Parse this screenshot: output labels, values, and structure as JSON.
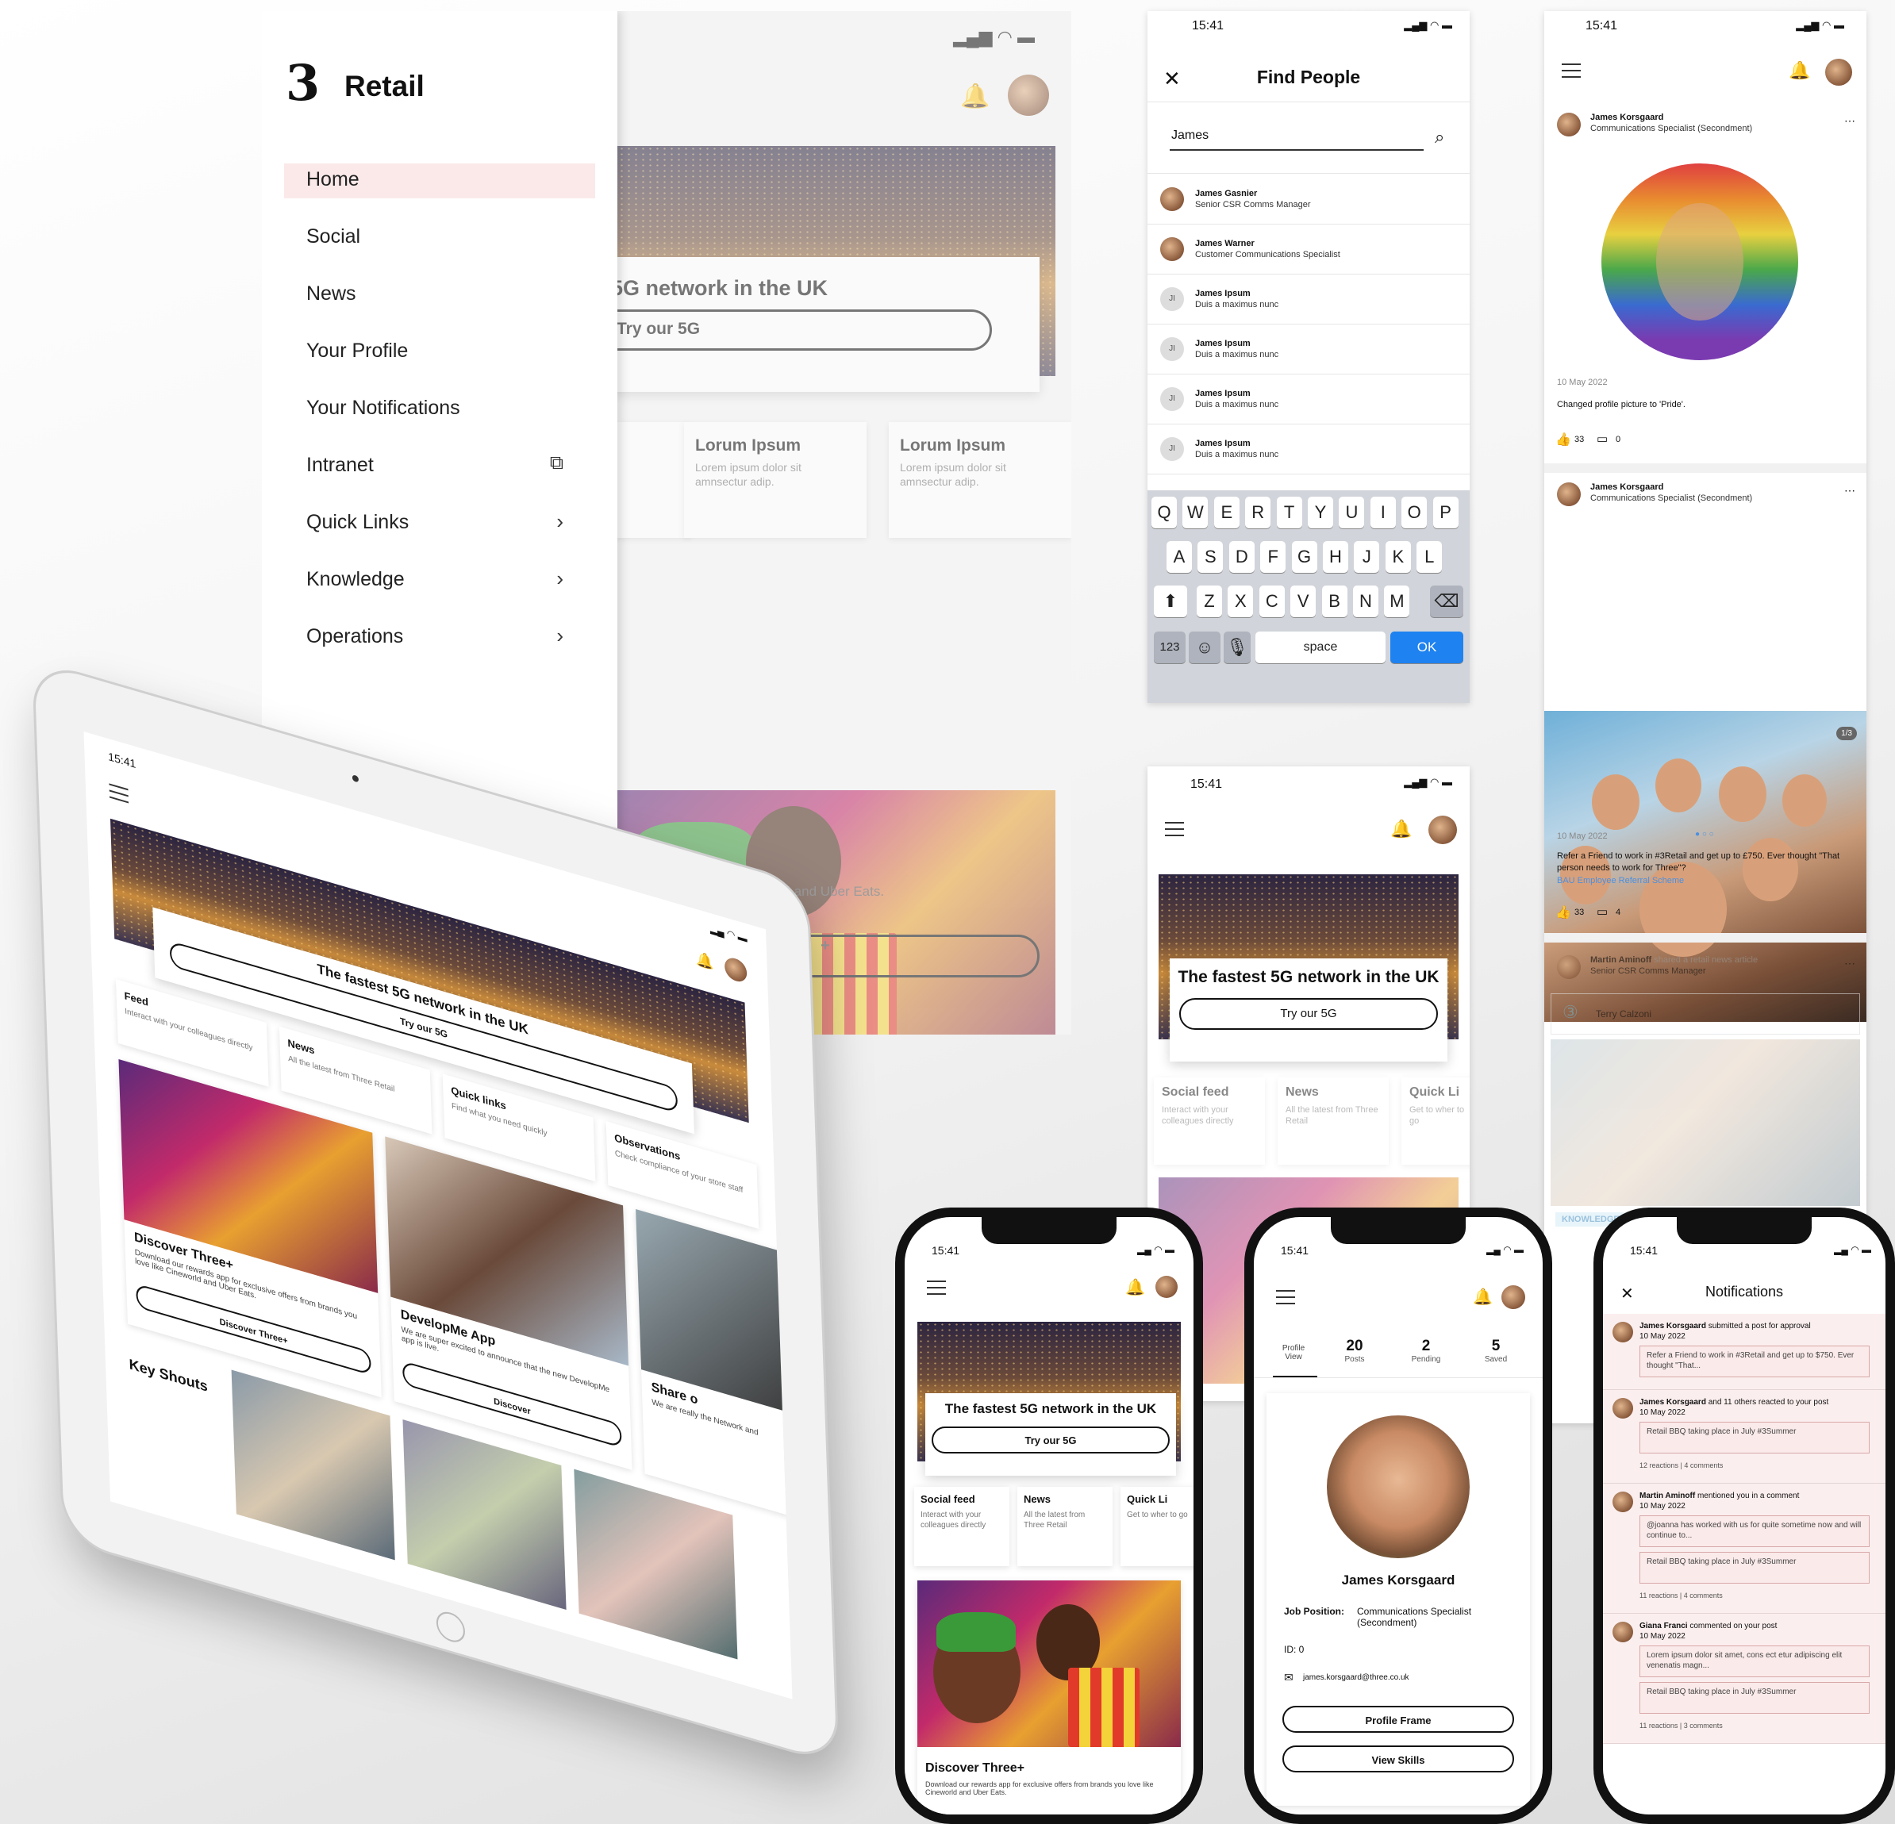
{
  "status": {
    "time": "15:41"
  },
  "drawer": {
    "brand": "Retail",
    "items": [
      {
        "label": "Home"
      },
      {
        "label": "Social"
      },
      {
        "label": "News"
      },
      {
        "label": "Your Profile"
      },
      {
        "label": "Your Notifications"
      },
      {
        "label": "Intranet"
      },
      {
        "label": "Quick Links"
      },
      {
        "label": "Knowledge"
      },
      {
        "label": "Operations"
      }
    ]
  },
  "home_bg": {
    "hero_title": "5G network in the UK",
    "hero_button": "Try our 5G",
    "tiles": [
      {
        "title": "Lorum Ipsum",
        "text": "Lorem ipsum dolor sit amnsectur adip."
      },
      {
        "title": "Lorum Ipsum",
        "text": "Lorem ipsum dolor sit amnsectur adip."
      }
    ],
    "promo_text": "ove like Cineworld and Uber Eats."
  },
  "find_people": {
    "title": "Find People",
    "query": "James",
    "results": [
      {
        "name": "James Gasnier",
        "role": "Senior CSR Comms Manager",
        "initials": ""
      },
      {
        "name": "James Warner",
        "role": "Customer Communications Specialist",
        "initials": ""
      },
      {
        "name": "James Ipsum",
        "role": "Duis a maximus nunc",
        "initials": "JI"
      },
      {
        "name": "James Ipsum",
        "role": "Duis a maximus nunc",
        "initials": "JI"
      },
      {
        "name": "James Ipsum",
        "role": "Duis a maximus nunc",
        "initials": "JI"
      },
      {
        "name": "James Ipsum",
        "role": "Duis a maximus nunc",
        "initials": "JI"
      }
    ],
    "keyboard": {
      "row1": [
        "Q",
        "W",
        "E",
        "R",
        "T",
        "Y",
        "U",
        "I",
        "O",
        "P"
      ],
      "row2": [
        "A",
        "S",
        "D",
        "F",
        "G",
        "H",
        "J",
        "K",
        "L"
      ],
      "row3": [
        "Z",
        "X",
        "C",
        "V",
        "B",
        "N",
        "M"
      ],
      "num": "123",
      "space": "space",
      "ok": "OK"
    }
  },
  "feed": {
    "post1": {
      "author": "James Korsgaard",
      "role": "Communications Specialist (Secondment)",
      "date": "10 May 2022",
      "text": "Changed profile picture to 'Pride'.",
      "likes": "33",
      "comments": "0"
    },
    "post2": {
      "author": "James Korsgaard",
      "role": "Communications Specialist (Secondment)",
      "counter": "1/3",
      "date": "10 May 2022",
      "text": "Refer a Friend to work in #3Retail and get up to £750. Ever thought \"That person needs to work for Three\"?",
      "link": "BAU Employee Referral Scheme",
      "likes": "33",
      "comments": "4"
    },
    "post3": {
      "author": "Martin Aminoff",
      "action": "shared a retail news article",
      "role": "Senior CSR Comms Manager",
      "shared_by": "Terry Calzoni",
      "tag": "KNOWLEDGE"
    }
  },
  "home_phone": {
    "hero_title": "The fastest 5G network in the UK",
    "hero_button": "Try our 5G",
    "tiles": [
      {
        "title": "Social feed",
        "text": "Interact with your colleagues directly"
      },
      {
        "title": "News",
        "text": "All the latest from Three Retail"
      },
      {
        "title": "Quick Li",
        "text": "Get to wher to go"
      }
    ]
  },
  "tablet": {
    "time": "15:41",
    "hero_title": "The fastest 5G network in the UK",
    "hero_button": "Try our 5G",
    "tiles": [
      {
        "title": "Feed",
        "text": "Interact with your colleagues directly"
      },
      {
        "title": "News",
        "text": "All the latest from Three Retail"
      },
      {
        "title": "Quick links",
        "text": "Find what you need quickly"
      },
      {
        "title": "Observations",
        "text": "Check compliance of your store staff"
      }
    ],
    "cards": [
      {
        "title": "Discover Three+",
        "text": "Download our rewards app for exclusive offers from brands you love like Cineworld and Uber Eats.",
        "button": "Discover Three+"
      },
      {
        "title": "DevelopMe App",
        "text": "We are super excited to announce that the new DevelopMe app is live.",
        "button": "Discover"
      },
      {
        "title": "Share o",
        "text": "We are really the Network and"
      }
    ],
    "section": "Key Shouts"
  },
  "phone1": {
    "time": "15:41",
    "hero_title": "The fastest 5G network in the UK",
    "hero_button": "Try our 5G",
    "tiles": [
      {
        "title": "Social feed",
        "text": "Interact with your colleagues directly"
      },
      {
        "title": "News",
        "text": "All the latest from Three Retail"
      },
      {
        "title": "Quick Li",
        "text": "Get to wher to go"
      }
    ],
    "promo_title": "Discover Three+",
    "promo_text": "Download our rewards app for exclusive offers from brands you love like Cineworld and Uber Eats."
  },
  "phone2": {
    "time": "15:41",
    "profile_tab": "Profile View",
    "stats": [
      {
        "num": "20",
        "label": "Posts"
      },
      {
        "num": "2",
        "label": "Pending"
      },
      {
        "num": "5",
        "label": "Saved"
      }
    ],
    "name": "James Korsgaard",
    "job_label": "Job Position:",
    "job_value": "Communications Specialist (Secondment)",
    "id": "ID: 0",
    "email": "james.korsgaard@three.co.uk",
    "btn1": "Profile Frame",
    "btn2": "View Skills"
  },
  "phone3": {
    "time": "15:41",
    "title": "Notifications",
    "items": [
      {
        "who": "James Korsgaard",
        "what": "submitted a post for approval",
        "date": "10 May 2022",
        "boxes": [
          "Refer a Friend to work in #3Retail and get up to $750. Ever thought \"That..."
        ],
        "footer": ""
      },
      {
        "who": "James Korsgaard",
        "what": "and 11 others reacted to your post",
        "date": "10 May 2022",
        "boxes": [
          "Retail BBQ taking place in July #3Summer"
        ],
        "footer": "12 reactions | 4 comments"
      },
      {
        "who": "Martin Aminoff",
        "what": "mentioned you in a comment",
        "date": "10 May 2022",
        "boxes": [
          "@joanna has worked with us for quite sometime now and will continue to...",
          "Retail BBQ taking place in July #3Summer"
        ],
        "footer": "11 reactions | 4 comments"
      },
      {
        "who": "Giana Franci",
        "what": "commented on your post",
        "date": "10 May 2022",
        "boxes": [
          "Lorem ipsum dolor sit amet, cons ect etur adipiscing elit venenatis magn...",
          "Retail BBQ taking place in July #3Summer"
        ],
        "footer": "11 reactions | 3 comments"
      }
    ]
  }
}
